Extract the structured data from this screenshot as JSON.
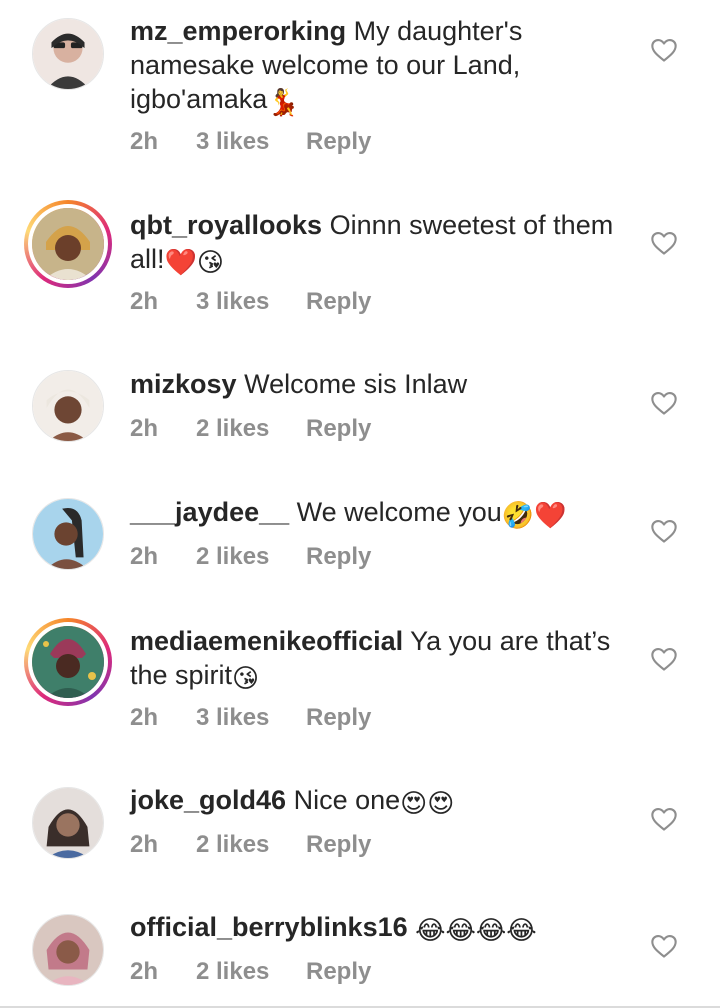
{
  "comments": [
    {
      "username": "mz_emperorking",
      "text": "My daughter's namesake welcome to our Land, igbo'amaka",
      "emoji": "💃",
      "time": "2h",
      "likes": "3 likes",
      "reply": "Reply",
      "story_ring": false,
      "avatar_color": "#c9a49a"
    },
    {
      "username": "qbt_royallooks",
      "text": "Oinnn sweetest of them all!",
      "emoji": "❤️😘",
      "time": "2h",
      "likes": "3 likes",
      "reply": "Reply",
      "story_ring": true,
      "avatar_color": "#d9a74a"
    },
    {
      "username": "mizkosy",
      "text": "Welcome sis Inlaw",
      "emoji": "",
      "time": "2h",
      "likes": "2 likes",
      "reply": "Reply",
      "story_ring": false,
      "avatar_color": "#7a4a3a"
    },
    {
      "username": "___jaydee__",
      "text": "We welcome you",
      "emoji": "🤣❤️",
      "time": "2h",
      "likes": "2 likes",
      "reply": "Reply",
      "story_ring": false,
      "avatar_color": "#8fc3e0"
    },
    {
      "username": "mediaemenikeofficial",
      "text": "Ya you are that’s the spirit",
      "emoji": "😘",
      "time": "2h",
      "likes": "3 likes",
      "reply": "Reply",
      "story_ring": true,
      "avatar_color": "#3f7f6a"
    },
    {
      "username": "joke_gold46",
      "text": "Nice one",
      "emoji": "😍😍",
      "time": "2h",
      "likes": "2 likes",
      "reply": "Reply",
      "story_ring": false,
      "avatar_color": "#b5a9a3"
    },
    {
      "username": "official_berryblinks16",
      "text": "",
      "emoji": "😂😂😂😂",
      "time": "2h",
      "likes": "2 likes",
      "reply": "Reply",
      "story_ring": false,
      "avatar_color": "#c79a92"
    }
  ],
  "icons": {
    "like": "heart-outline-icon"
  },
  "colors": {
    "text": "#262626",
    "meta": "#8e8e8e",
    "heart_stroke": "#8e8e8e"
  }
}
